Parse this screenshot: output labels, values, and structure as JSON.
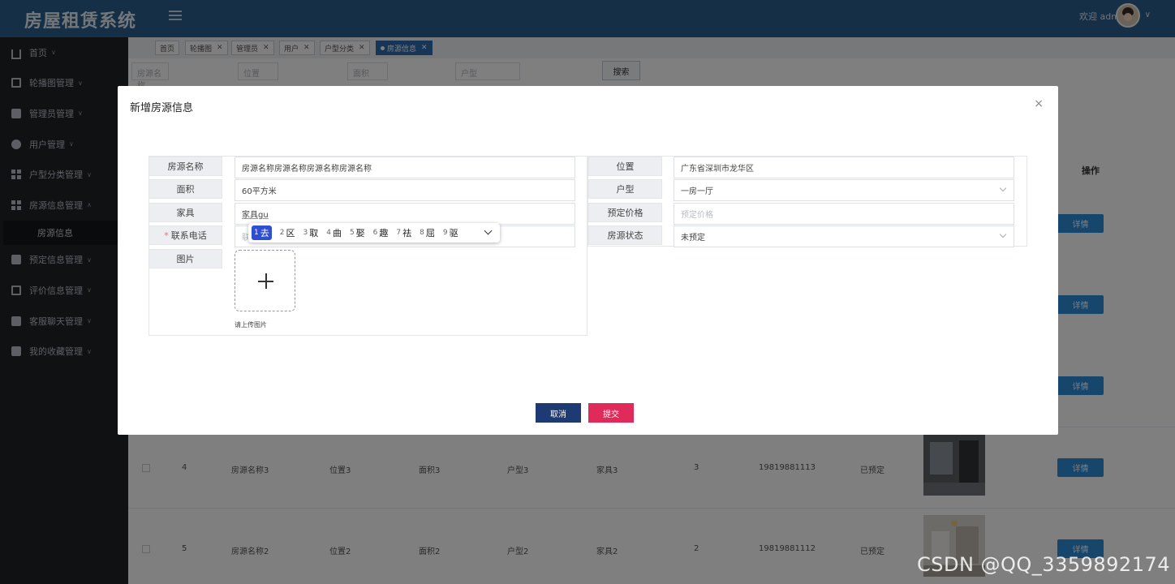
{
  "header": {
    "title": "房屋租赁系统",
    "welcome": "欢迎 admin"
  },
  "sidebar": {
    "items": [
      {
        "label": "首页",
        "icon": "home-icon"
      },
      {
        "label": "轮播图管理",
        "icon": "image-icon"
      },
      {
        "label": "管理员管理",
        "icon": "admin-icon"
      },
      {
        "label": "用户管理",
        "icon": "user-icon"
      },
      {
        "label": "户型分类管理",
        "icon": "grid-icon"
      },
      {
        "label": "房源信息管理",
        "icon": "apps-icon"
      },
      {
        "label": "预定信息管理",
        "icon": "copy-icon"
      },
      {
        "label": "评价信息管理",
        "icon": "comment-icon"
      },
      {
        "label": "客服聊天管理",
        "icon": "chat-icon"
      },
      {
        "label": "我的收藏管理",
        "icon": "star-icon"
      }
    ],
    "sub_item": "房源信息"
  },
  "tabs": [
    "首页",
    "轮播图",
    "管理员",
    "用户",
    "户型分类",
    "房源信息"
  ],
  "search": {
    "name_placeholder": "房源名称",
    "location_placeholder": "位置",
    "area_placeholder": "面积",
    "type_placeholder": "户型",
    "button": "搜索"
  },
  "table": {
    "op_header": "操作",
    "detail_label": "详情",
    "rows": [
      {
        "index": "4",
        "name": "房源名称3",
        "location": "位置3",
        "area": "面积3",
        "type": "户型3",
        "furniture": "家具3",
        "count": "3",
        "phone": "19819881113",
        "status": "已预定"
      },
      {
        "index": "5",
        "name": "房源名称2",
        "location": "位置2",
        "area": "面积2",
        "type": "户型2",
        "furniture": "家具2",
        "count": "2",
        "phone": "19819881112",
        "status": "已预定"
      }
    ]
  },
  "dialog": {
    "title": "新增房源信息",
    "labels": {
      "name": "房源名称",
      "area": "面积",
      "furniture": "家具",
      "phone": "联系电话",
      "image": "图片",
      "location": "位置",
      "type": "户型",
      "price": "预定价格",
      "status": "房源状态"
    },
    "values": {
      "name": "房源名称房源名称房源名称房源名称",
      "area": "60平方米",
      "furniture": "家具gu",
      "phone_partial": "联",
      "location": "广东省深圳市龙华区",
      "type": "一房一厅",
      "price_placeholder": "预定价格",
      "status": "未预定"
    },
    "upload_hint": "请上传图片",
    "cancel": "取消",
    "submit": "提交"
  },
  "ime": {
    "candidates": [
      {
        "n": "1",
        "c": "去"
      },
      {
        "n": "2",
        "c": "区"
      },
      {
        "n": "3",
        "c": "取"
      },
      {
        "n": "4",
        "c": "曲"
      },
      {
        "n": "5",
        "c": "娶"
      },
      {
        "n": "6",
        "c": "趣"
      },
      {
        "n": "7",
        "c": "祛"
      },
      {
        "n": "8",
        "c": "屈"
      },
      {
        "n": "9",
        "c": "驱"
      }
    ]
  },
  "watermark": "CSDN @QQ_3359892174"
}
